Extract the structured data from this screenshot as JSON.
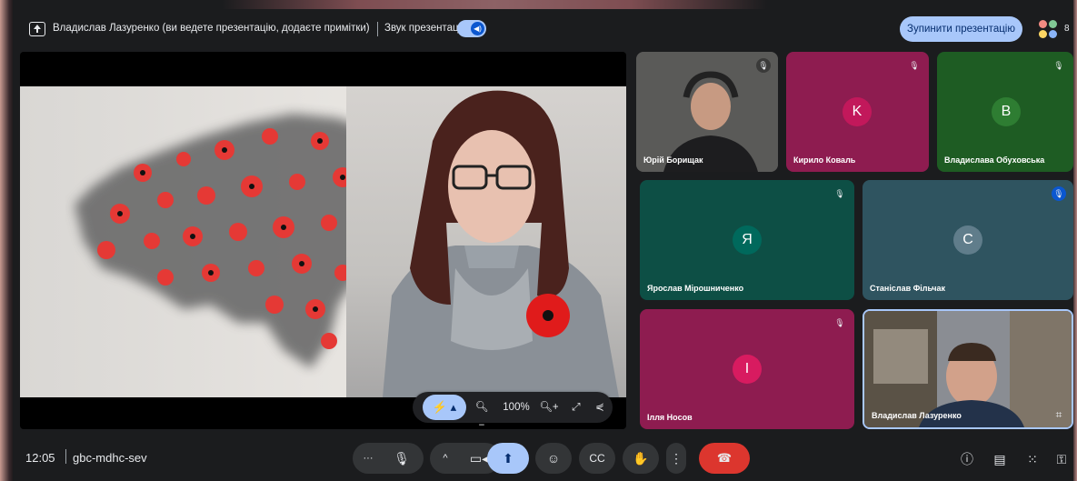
{
  "topbar": {
    "presenter_text": "Владислав Лазуренко (ви ведете презентацію, додаєте примітки)",
    "sound_label": "Звук презентації",
    "stop_button": "Зупинити презентацію",
    "participant_count": "8"
  },
  "presentation": {
    "laser_label": "⚡ ▴",
    "zoom_out": "🔍︎−",
    "zoom_level": "100%",
    "zoom_in": "🔍︎+",
    "fullscreen": "⤢",
    "share": "⋞"
  },
  "participants": [
    {
      "name": "Юрій Борищак",
      "initial": "",
      "bg": "#2c2d30",
      "muted": true
    },
    {
      "name": "Кирило Коваль",
      "initial": "K",
      "bg": "#8e1c50",
      "avatar": "#c2185b",
      "muted": true
    },
    {
      "name": "Владислава Обуховська",
      "initial": "B",
      "bg": "#1e5c23",
      "avatar": "#2e7d32",
      "muted": true
    },
    {
      "name": "Ярослав Мірошниченко",
      "initial": "Я",
      "bg": "#0d4f45",
      "avatar": "#00695c",
      "muted": true
    },
    {
      "name": "Станіслав Фільчак",
      "initial": "C",
      "bg": "#2f5460",
      "avatar": "#607d8b",
      "muted": true
    },
    {
      "name": "Ілля Носов",
      "initial": "I",
      "bg": "#8e1c50",
      "avatar": "#d81b60",
      "muted": true
    },
    {
      "name": "Владислав Лазуренко",
      "initial": "",
      "bg": "#3a3a3a",
      "muted": false
    }
  ],
  "bottombar": {
    "time": "12:05",
    "meeting_code": "gbc-mdhc-sev"
  },
  "colors": {
    "accent": "#a8c7fa",
    "end_call": "#dc362e",
    "presenting": "#a8c7fa"
  },
  "icons": [
    "present-icon",
    "mic-icon",
    "camera-icon",
    "present-screen-icon",
    "emoji-icon",
    "captions-icon",
    "hand-icon",
    "more-icon",
    "end-call-icon",
    "info-icon",
    "chat-icon",
    "activities-icon",
    "lock-icon"
  ]
}
